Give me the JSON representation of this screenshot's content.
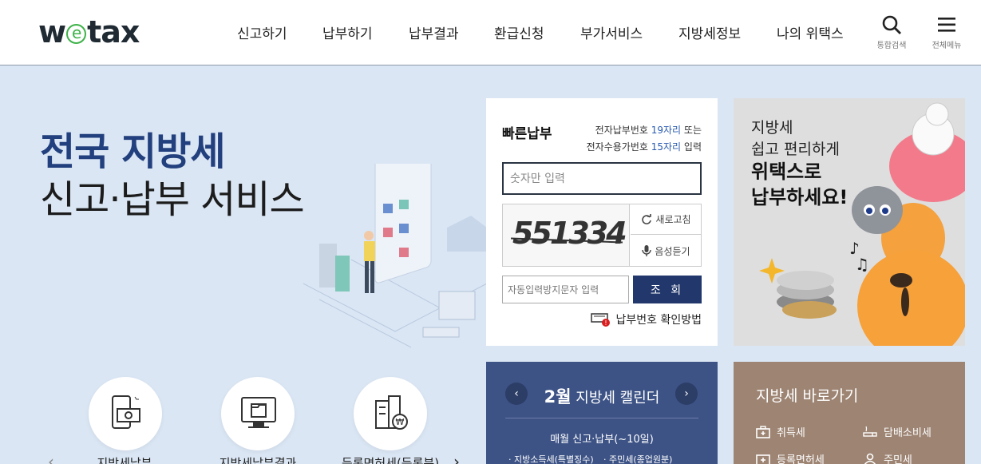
{
  "header": {
    "logo": {
      "pre": "w",
      "mid": "e",
      "post": "tax"
    },
    "nav": [
      "신고하기",
      "납부하기",
      "납부결과",
      "환급신청",
      "부가서비스",
      "지방세정보",
      "나의 위택스"
    ],
    "search_label": "통합검색",
    "menu_label": "전체메뉴"
  },
  "hero": {
    "title_line1": "전국 지방세",
    "title_line2": "신고·납부 서비스"
  },
  "quick_links": [
    {
      "label": "지방세납부",
      "icon": "tax-payment-icon"
    },
    {
      "label": "지방세납부결과",
      "icon": "payment-result-icon"
    },
    {
      "label": "등록면허세(등록분)",
      "icon": "building-won-icon"
    }
  ],
  "quick_pay": {
    "title": "빠른납부",
    "info_line1_pre": "전자납부번호 ",
    "info_line1_hl": "19자리",
    "info_line1_post": " 또는",
    "info_line2_pre": "전자수용가번호 ",
    "info_line2_hl": "15자리",
    "info_line2_post": " 입력",
    "number_placeholder": "숫자만 입력",
    "captcha_code": "551334",
    "refresh_label": "새로고침",
    "audio_label": "음성듣기",
    "captcha_placeholder": "자동입력방지문자 입력",
    "search_button": "조 회",
    "howto_label": "납부번호 확인방법"
  },
  "banner": {
    "line1": "지방세",
    "line2": "쉽고 편리하게",
    "line3": "위택스로",
    "line4": "납부하세요!"
  },
  "calendar": {
    "month": "2월",
    "title": "지방세 캘린더",
    "subtitle": "매월 신고·납부(~10일)",
    "items": [
      "· 지방소득세(특별징수)",
      "· 주민세(종업원분)"
    ]
  },
  "shortcut": {
    "title": "지방세 바로가기",
    "items": [
      "취득세",
      "담배소비세",
      "등록면허세",
      "주민세"
    ]
  },
  "colors": {
    "hero_blue": "#23407e",
    "search_button": "#22376b",
    "calendar_bg": "#3d5386",
    "shortcut_bg": "#9d8473",
    "logo_green": "#3db248"
  }
}
